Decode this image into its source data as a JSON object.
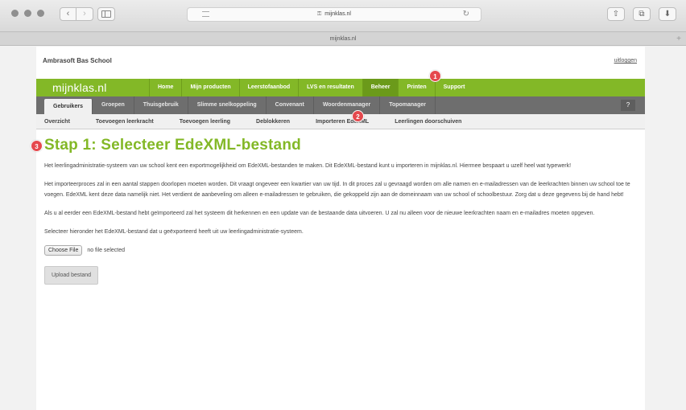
{
  "browser": {
    "url": "mijnklas.nl",
    "tab_title": "mijnklas.nl",
    "back_glyph": "‹",
    "forward_glyph": "›",
    "reload_glyph": "↻",
    "share_glyph": "⇧",
    "tabs_glyph": "⧉",
    "download_glyph": "⬇",
    "new_tab_glyph": "+"
  },
  "header": {
    "school_name": "Ambrasoft Bas School",
    "logout_label": "uitloggen"
  },
  "main_nav": {
    "logo": "mijnklas.nl",
    "items": [
      "Home",
      "Mijn producten",
      "Leerstofaanbod",
      "LVS en resultaten",
      "Beheer",
      "Printen",
      "Support"
    ],
    "active": "Beheer"
  },
  "sub_nav": {
    "items": [
      "Gebruikers",
      "Groepen",
      "Thuisgebruik",
      "Slimme snelkoppeling",
      "Convenant",
      "Woordenmanager",
      "Topomanager"
    ],
    "active": "Gebruikers",
    "help_label": "?"
  },
  "sub_sub_nav": {
    "items": [
      "Overzicht",
      "Toevoegen leerkracht",
      "Toevoegen leerling",
      "Deblokkeren",
      "Importeren EdeXML",
      "Leerlingen doorschuiven"
    ]
  },
  "content": {
    "title": "Stap 1: Selecteer EdeXML-bestand",
    "paragraphs": [
      "Het leerlingadministratie-systeem van uw school kent een exportmogelijkheid om EdeXML-bestanden te maken. Dit EdeXML-bestand kunt u importeren in mijnklas.nl. Hiermee bespaart u uzelf heel wat typewerk!",
      "Het importeerproces zal in een aantal stappen doorlopen moeten worden. Dit vraagt ongeveer een kwartier van uw tijd. In dit proces zal u gevraagd worden om alle namen en e-mailadressen van de leerkrachten binnen uw school toe te voegen. EdeXML kent deze data namelijk niet. Het verdient de aanbeveling om alleen e-mailadressen te gebruiken, die gekoppeld zijn aan de domeinnaam van uw school of schoolbestuur. Zorg dat u deze gegevens bij de hand hebt!",
      "Als u al eerder een EdeXML-bestand hebt geïmporteerd zal het systeem dit herkennen en een update van de bestaande data uitvoeren. U zal nu alleen voor de nieuwe leerkrachten naam en e-mailadres moeten opgeven.",
      "Selecteer hieronder het EdeXML-bestand dat u geëxporteerd heeft uit uw leerlingadministratie-systeem."
    ],
    "file_button": "Choose File",
    "file_status": "no file selected",
    "upload_button": "Upload bestand"
  },
  "badges": [
    "1",
    "2",
    "3"
  ],
  "colors": {
    "green": "#83b827",
    "green_active": "#6b9a1a",
    "grey_nav": "#6e6e6e",
    "badge_red": "#e5484d"
  }
}
